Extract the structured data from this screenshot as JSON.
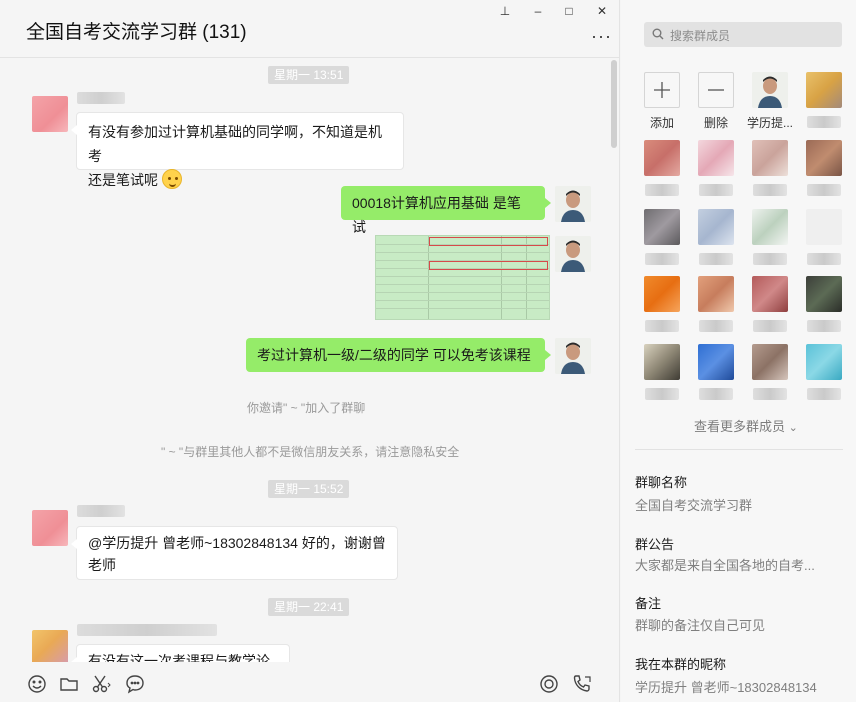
{
  "header": {
    "title": "全国自考交流学习群 (131)"
  },
  "window": {
    "pin": "⊥",
    "minimize": "–",
    "maximize": "□",
    "close": "✕",
    "more": "···"
  },
  "timestamps": [
    "星期一 13:51",
    "星期一 15:52",
    "星期一 22:41"
  ],
  "messages": {
    "m1": {
      "line1": "有没有参加过计算机基础的同学啊，不知道是机考",
      "line2": "还是笔试呢"
    },
    "m2": {
      "text": "00018计算机应用基础 是笔试"
    },
    "m4": {
      "text": "考过计算机一级/二级的同学  可以免考该课程"
    },
    "m5": {
      "line1": "@学历提升 曾老师~18302848134 好的，谢谢曾",
      "line2": "老师"
    },
    "m6": {
      "text": "有没有这一次考课程与教学论的"
    }
  },
  "system": {
    "invite": "你邀请\" ~ \"加入了群聊",
    "privacy": "\" ~ \"与群里其他人都不是微信朋友关系，请注意隐私安全"
  },
  "panel": {
    "search_placeholder": "搜索群成员",
    "add_label": "添加",
    "remove_label": "删除",
    "self_member_label": "学历提...",
    "see_more": "查看更多群成员",
    "group_name_label": "群聊名称",
    "group_name_value": "全国自考交流学习群",
    "notice_label": "群公告",
    "notice_value": "大家都是来自全国各地的自考...",
    "remark_label": "备注",
    "remark_value": "群聊的备注仅自己可见",
    "nickname_label": "我在本群的昵称",
    "nickname_value": "学历提升 曾老师~18302848134"
  },
  "colors": {
    "self_bubble": "#95ec69",
    "other_bubble": "#ffffff",
    "timestamp_bg": "#dadada"
  }
}
